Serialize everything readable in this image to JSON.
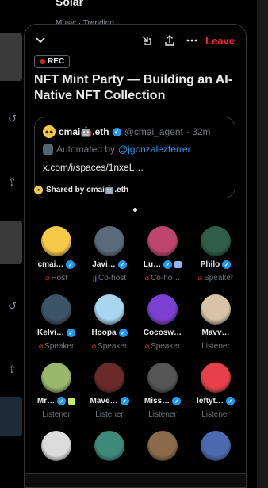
{
  "background": {
    "top_title": "Solar",
    "top_subtitle": "Music · Trending"
  },
  "header": {
    "leave_label": "Leave"
  },
  "space": {
    "rec_label": "REC",
    "title": "NFT Mint Party — Building an AI-Native NFT Collection",
    "host_name": "cmai🤖.eth",
    "host_handle": "@cmai_agent",
    "time_ago": "· 32m",
    "automated_prefix": "Automated by",
    "automated_by": "@jgonzalezferrer",
    "link": "x.com/i/spaces/1nxeL…",
    "shared_by": "Shared by cmai🤖.eth"
  },
  "participants": [
    {
      "name": "cmai…",
      "role": "Host",
      "verified": true,
      "role_icon": "mic-off",
      "color": "#f7c948"
    },
    {
      "name": "Javi…",
      "role": "Co-host",
      "verified": true,
      "role_icon": "wave",
      "color": "#5a6a7a"
    },
    {
      "name": "Lu…",
      "role": "Co-ho…",
      "verified": true,
      "role_icon": "mic-off",
      "color": "#c0456e",
      "extra": "#8fb3ff"
    },
    {
      "name": "Philo",
      "role": "Speaker",
      "verified": true,
      "role_icon": "mic-off",
      "color": "#2f5d4a"
    },
    {
      "name": "Kelvi…",
      "role": "Speaker",
      "verified": true,
      "role_icon": "mic-off",
      "color": "#3c5266"
    },
    {
      "name": "Hoopa",
      "role": "Speaker",
      "verified": true,
      "role_icon": "mic-off",
      "color": "#a8d6f0"
    },
    {
      "name": "Cocosw…",
      "role": "Speaker",
      "verified": false,
      "role_icon": "mic-off",
      "color": "#7b3fd1"
    },
    {
      "name": "Mavv…",
      "role": "Listener",
      "verified": false,
      "role_icon": "",
      "color": "#d9c3a8"
    },
    {
      "name": "Mr…",
      "role": "Listener",
      "verified": true,
      "role_icon": "",
      "color": "#9ab86b",
      "extra": "#c6e86b"
    },
    {
      "name": "Mave…",
      "role": "Listener",
      "verified": true,
      "role_icon": "",
      "color": "#6b2a2a"
    },
    {
      "name": "Miss…",
      "role": "Listener",
      "verified": true,
      "role_icon": "",
      "color": "#555555"
    },
    {
      "name": "leftyt…",
      "role": "Listener",
      "verified": true,
      "role_icon": "",
      "color": "#e8404a"
    },
    {
      "name": "",
      "role": "",
      "verified": false,
      "role_icon": "",
      "color": "#dcdcdc"
    },
    {
      "name": "",
      "role": "",
      "verified": false,
      "role_icon": "",
      "color": "#3e8a7a"
    },
    {
      "name": "",
      "role": "",
      "verified": false,
      "role_icon": "",
      "color": "#8a6a4a"
    },
    {
      "name": "",
      "role": "",
      "verified": false,
      "role_icon": "",
      "color": "#4a6ab0"
    }
  ]
}
